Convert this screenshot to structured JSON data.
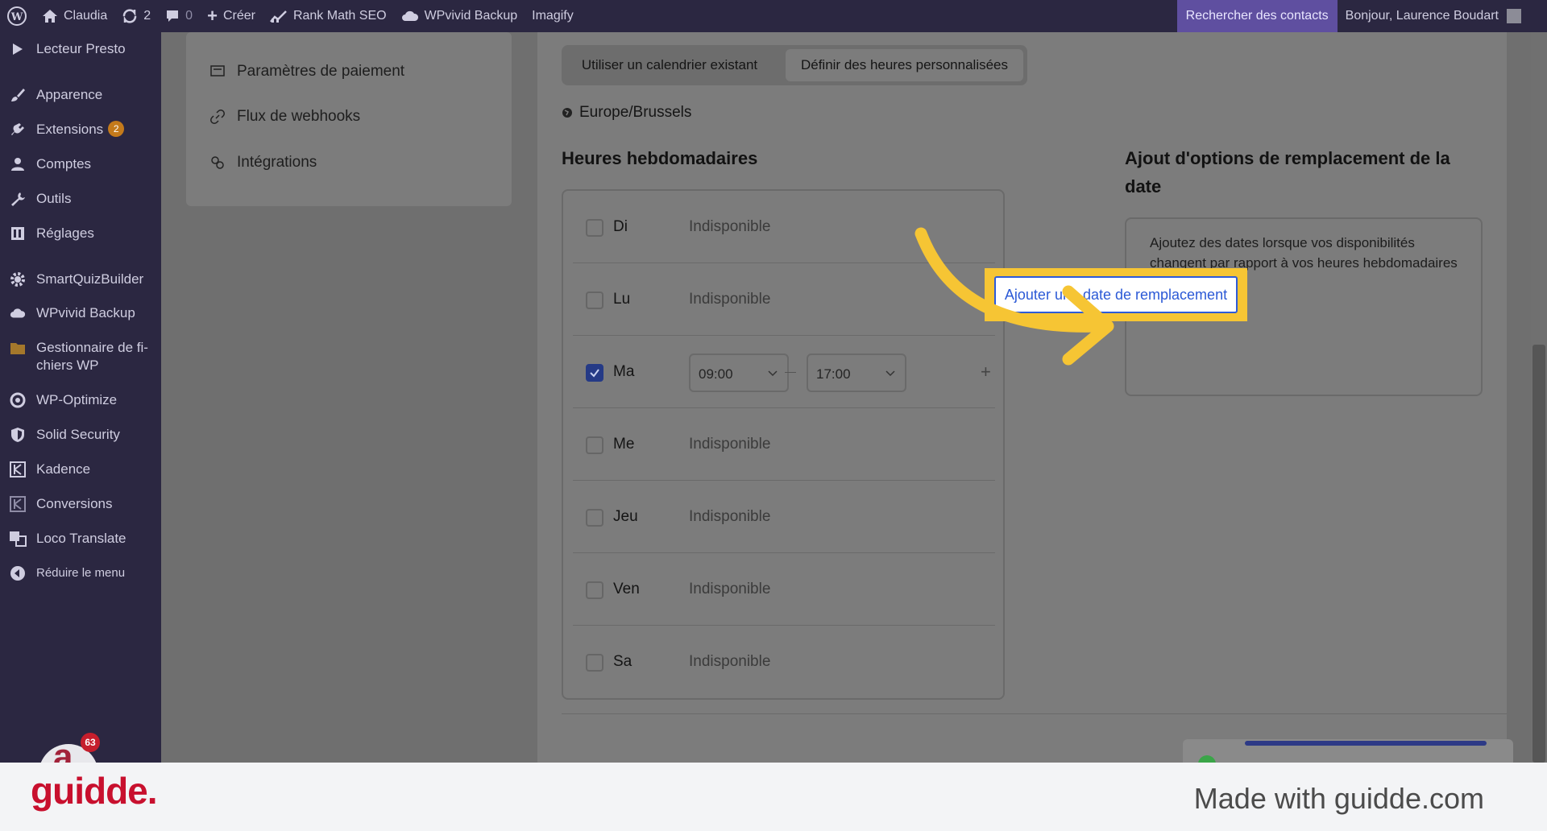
{
  "adminbar": {
    "site_name": "Claudia",
    "updates_count": "2",
    "comments_count": "0",
    "create_label": "Créer",
    "rankmath_label": "Rank Math SEO",
    "wpvivid_label": "WPvivid Backup",
    "imagify_label": "Imagify",
    "search_contacts_label": "Rechercher des contacts",
    "greeting": "Bonjour, Laurence Boudart"
  },
  "sidebar": {
    "items": [
      {
        "label": "Lecteur Presto",
        "icon": "presto-icon"
      },
      {
        "label": "Apparence",
        "icon": "brush-icon"
      },
      {
        "label": "Extensions",
        "icon": "plugin-icon",
        "badge": "2"
      },
      {
        "label": "Comptes",
        "icon": "user-icon"
      },
      {
        "label": "Outils",
        "icon": "wrench-icon"
      },
      {
        "label": "Réglages",
        "icon": "settings-icon"
      },
      {
        "label": "SmartQuizBuilder",
        "icon": "gear-icon"
      },
      {
        "label": "WPvivid Backup",
        "icon": "cloud-icon"
      },
      {
        "label": "Gestionnaire de fi-",
        "label2": "chiers WP",
        "icon": "folder-icon"
      },
      {
        "label": "WP-Optimize",
        "icon": "optimize-icon"
      },
      {
        "label": "Solid Security",
        "icon": "shield-icon"
      },
      {
        "label": "Kadence",
        "icon": "kadence-icon"
      },
      {
        "label": "Conversions",
        "icon": "conversions-icon"
      },
      {
        "label": "Loco Translate",
        "icon": "translate-icon"
      },
      {
        "label": "Réduire le menu",
        "icon": "collapse-icon"
      }
    ],
    "notification_badge": "63",
    "bubble_letter": "a"
  },
  "settings_nav": {
    "items": [
      {
        "label": "Paramètres de paiement",
        "icon": "payment-icon"
      },
      {
        "label": "Flux de webhooks",
        "icon": "link-icon"
      },
      {
        "label": "Intégrations",
        "icon": "integrations-icon"
      }
    ]
  },
  "availability": {
    "tab_existing": "Utiliser un calendrier existant",
    "tab_custom": "Définir des heures personnalisées",
    "timezone": "Europe/Brussels",
    "weekly_title": "Heures hebdomadaires",
    "days": [
      {
        "name": "Di",
        "checked": false,
        "status": "Indisponible"
      },
      {
        "name": "Lu",
        "checked": false,
        "status": "Indisponible"
      },
      {
        "name": "Ma",
        "checked": true,
        "start": "09:00",
        "end": "17:00"
      },
      {
        "name": "Me",
        "checked": false,
        "status": "Indisponible"
      },
      {
        "name": "Jeu",
        "checked": false,
        "status": "Indisponible"
      },
      {
        "name": "Ven",
        "checked": false,
        "status": "Indisponible"
      },
      {
        "name": "Sa",
        "checked": false,
        "status": "Indisponible"
      }
    ],
    "override_title_line1": "Ajout d'options de remplacement de la",
    "override_title_line2": "date",
    "override_description": "Ajoutez des dates lorsque vos disponibilités changent par rapport à vos heures hebdomadaires",
    "add_override_button": "Ajouter une date de remplacement"
  },
  "colors": {
    "admin_bar": "#2b2741",
    "highlight": "#f6c534",
    "button_text": "#2b59d6",
    "guidde_red": "#c8102e"
  },
  "footer": {
    "logo": "guidde.",
    "made_with": "Made with guidde.com"
  }
}
